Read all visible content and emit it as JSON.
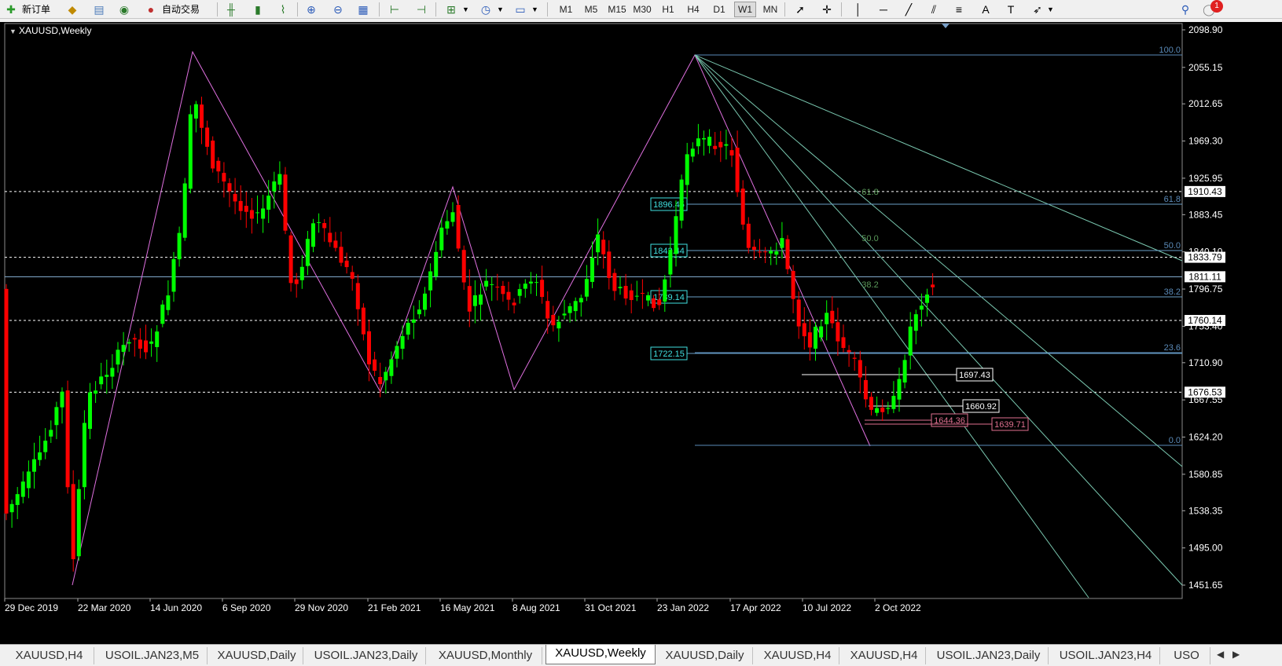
{
  "toolbar": {
    "new_order": "新订单",
    "auto_trading": "自动交易",
    "timeframes": [
      "M1",
      "M5",
      "M15",
      "M30",
      "H1",
      "H4",
      "D1",
      "W1",
      "MN"
    ],
    "active_timeframe": "W1",
    "alert_count": "1"
  },
  "chart": {
    "title": "XAUUSD,Weekly",
    "background": "#000000",
    "bull_color": "#00ff00",
    "bear_color": "#ff0000",
    "price_labels": [
      "2098.90",
      "2055.15",
      "2012.65",
      "1969.30",
      "1925.95",
      "1883.45",
      "1840.10",
      "1796.75",
      "1753.40",
      "1710.90",
      "1667.55",
      "1624.20",
      "1580.85",
      "1538.35",
      "1495.00",
      "1451.65"
    ],
    "date_labels": [
      "29 Dec 2019",
      "22 Mar 2020",
      "14 Jun 2020",
      "6 Sep 2020",
      "29 Nov 2020",
      "21 Feb 2021",
      "16 May 2021",
      "8 Aug 2021",
      "31 Oct 2021",
      "23 Jan 2022",
      "17 Apr 2022",
      "10 Jul 2022",
      "2 Oct 2022"
    ],
    "hlines_dashed": [
      "1910.43",
      "1833.79",
      "1760.14",
      "1676.53"
    ],
    "hline_solid": "1811.11",
    "fib_levels": [
      "100.0",
      "61.8",
      "50.0",
      "38.2",
      "23.6",
      "0.0"
    ],
    "fan_labels": [
      "61.8",
      "50.0",
      "38.2"
    ],
    "left_box_labels": [
      "1896.45",
      "1842.44",
      "1789.14",
      "1722.15"
    ],
    "white_box_labels": [
      "1697.43",
      "1660.92"
    ],
    "pink_box_labels": [
      "1644.36",
      "1639.71"
    ]
  },
  "tabs": [
    "XAUUSD,H4",
    "USOIL.JAN23,M5",
    "XAUUSD,Daily",
    "USOIL.JAN23,Daily",
    "XAUUSD,Monthly",
    "XAUUSD,Weekly",
    "XAUUSD,Daily",
    "XAUUSD,H4",
    "XAUUSD,H4",
    "USOIL.JAN23,Daily",
    "USOIL.JAN23,H4",
    "USO"
  ],
  "active_tab": "XAUUSD,Weekly"
}
